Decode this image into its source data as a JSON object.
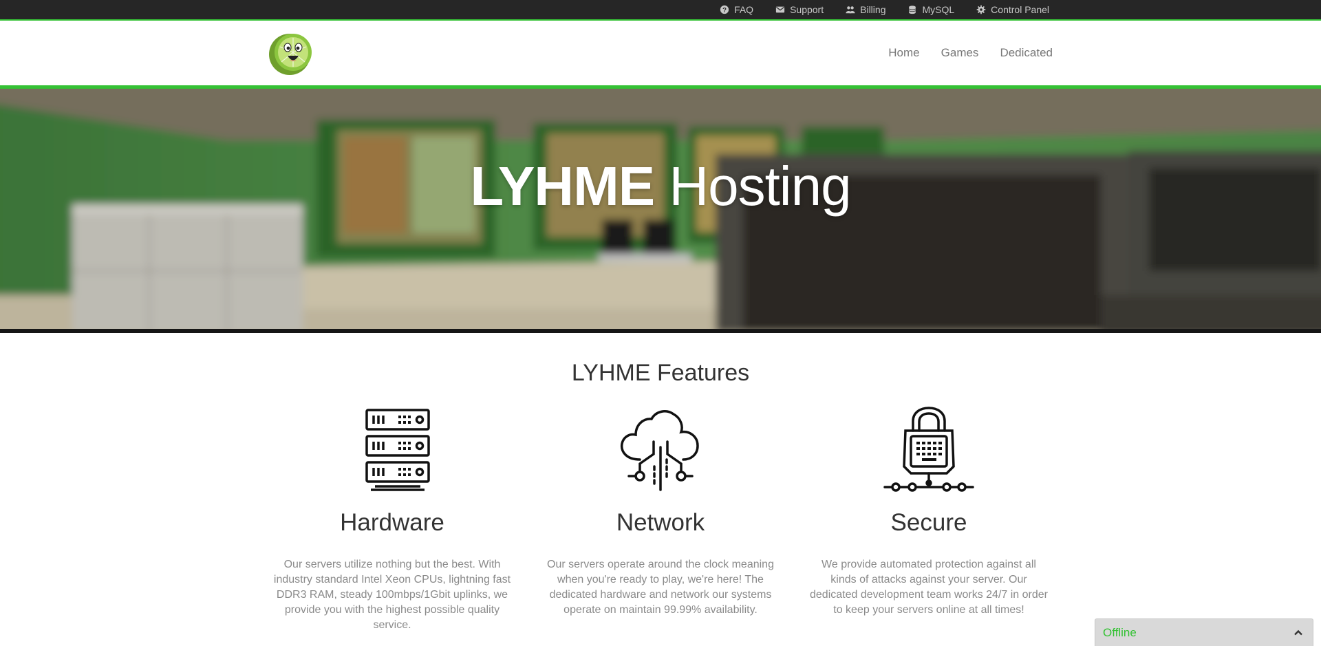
{
  "topbar": {
    "links": [
      {
        "label": "FAQ",
        "icon": "question-circle-icon"
      },
      {
        "label": "Support",
        "icon": "envelope-icon"
      },
      {
        "label": "Billing",
        "icon": "users-icon"
      },
      {
        "label": "MySQL",
        "icon": "database-icon"
      },
      {
        "label": "Control Panel",
        "icon": "gear-icon"
      }
    ]
  },
  "header": {
    "logo_icon": "lime-mascot-logo",
    "nav": [
      {
        "label": "Home"
      },
      {
        "label": "Games"
      },
      {
        "label": "Dedicated"
      }
    ]
  },
  "hero": {
    "title_strong": "LYHME",
    "title_light": "Hosting"
  },
  "features": {
    "title": "LYHME Features",
    "items": [
      {
        "icon": "server-rack-icon",
        "title": "Hardware",
        "text": "Our servers utilize nothing but the best. With industry standard Intel Xeon CPUs, lightning fast DDR3 RAM, steady 100mbps/1Gbit uplinks, we provide you with the highest possible quality service."
      },
      {
        "icon": "cloud-network-icon",
        "title": "Network",
        "text": "Our servers operate around the clock meaning when you're ready to play, we're here! The dedicated hardware and network our systems operate on maintain 99.99% availability."
      },
      {
        "icon": "padlock-network-icon",
        "title": "Secure",
        "text": "We provide automated protection against all kinds of attacks against your server. Our dedicated development team works 24/7 in order to keep your servers online at all times!"
      }
    ]
  },
  "chat": {
    "status": "Offline",
    "icon": "chevron-up-icon"
  },
  "colors": {
    "accent": "#35c235",
    "topbar": "#262626",
    "text_dark": "#333333",
    "text_muted": "#8a8a8a"
  }
}
